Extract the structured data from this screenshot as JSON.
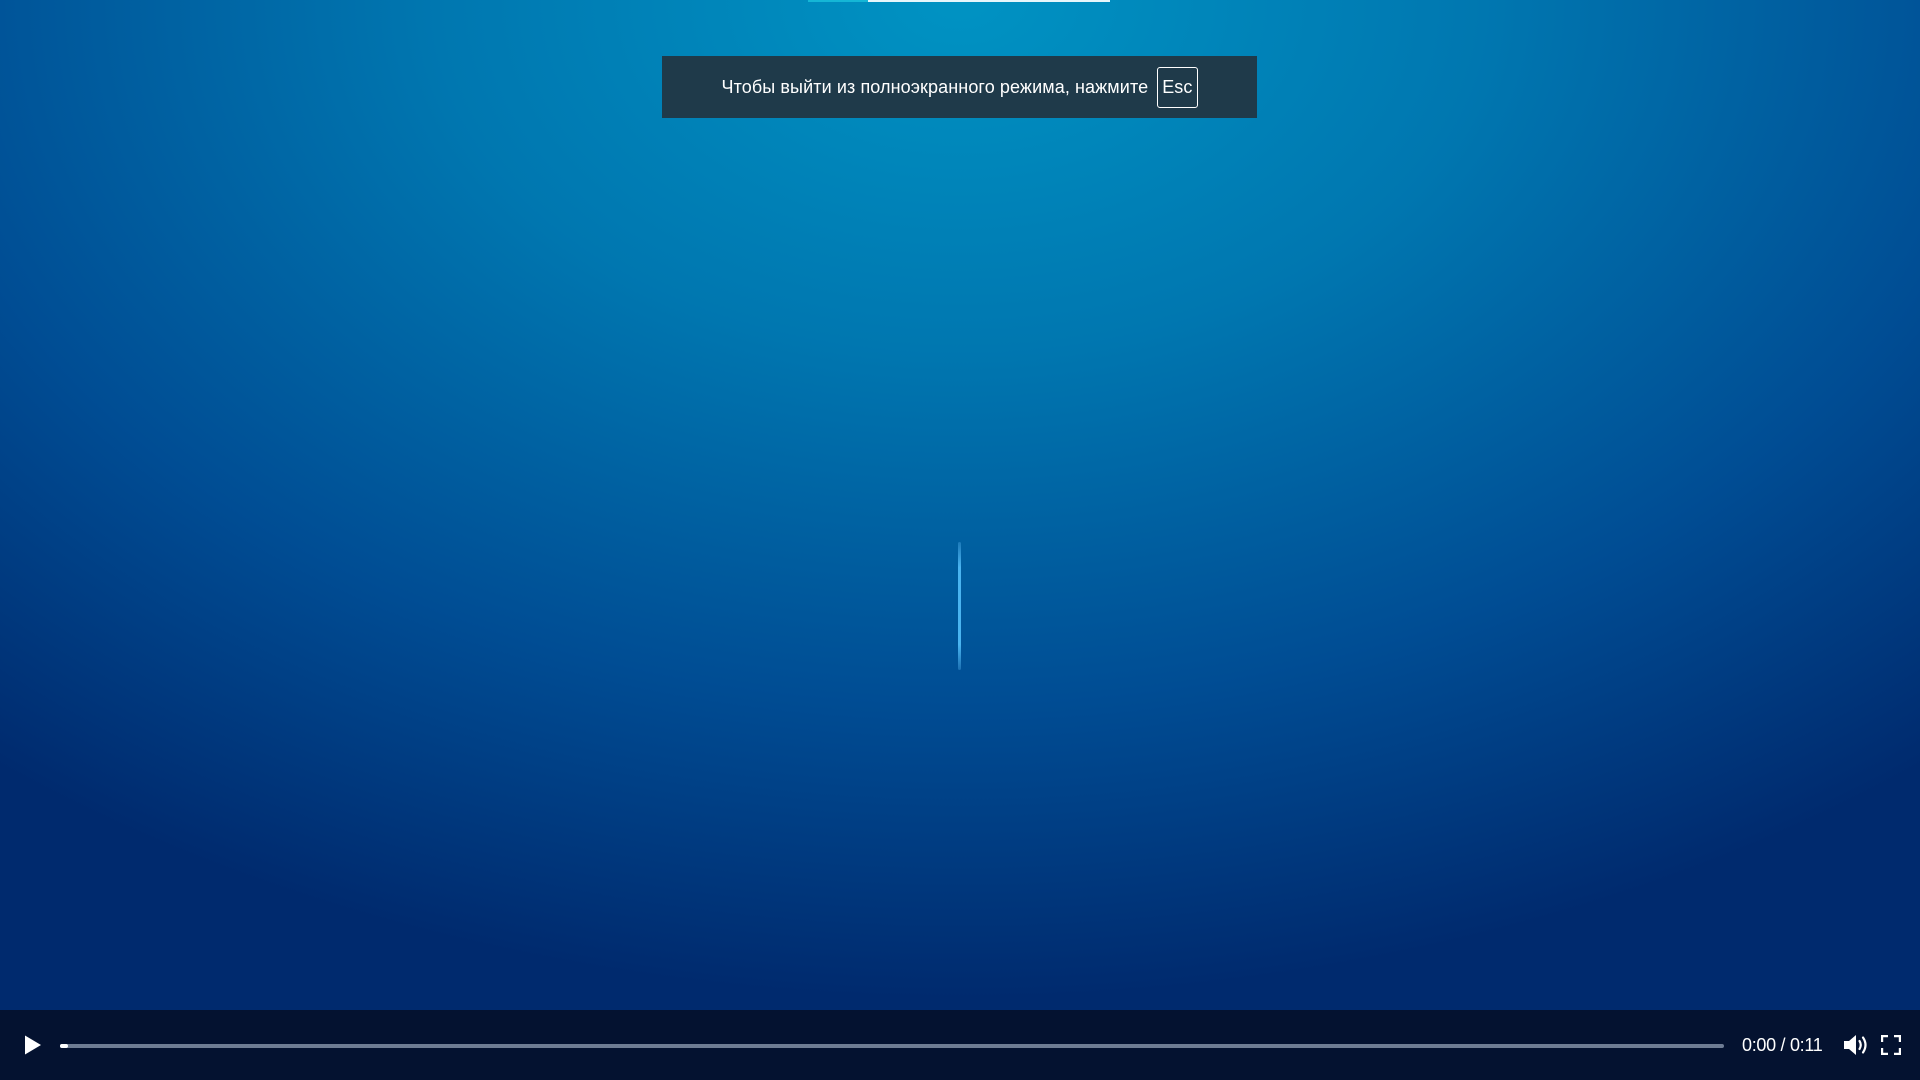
{
  "notice": {
    "text": "Чтобы выйти из полноэкранного режима, нажмите",
    "key": "Esc"
  },
  "player": {
    "current_time": "0:00",
    "separator": "/",
    "duration": "0:11",
    "progress_fraction": 0.005,
    "state": "paused"
  },
  "icons": {
    "play": "play-icon",
    "volume": "volume-icon",
    "fullscreen": "fullscreen-icon"
  },
  "colors": {
    "background_center": "#0093c3",
    "background_edge": "#002a6e",
    "notice_bg": "#1f3a4a",
    "controls_bg": "#041230",
    "progress_track": "#6e7c93",
    "progress_fill": "#ffffff"
  }
}
